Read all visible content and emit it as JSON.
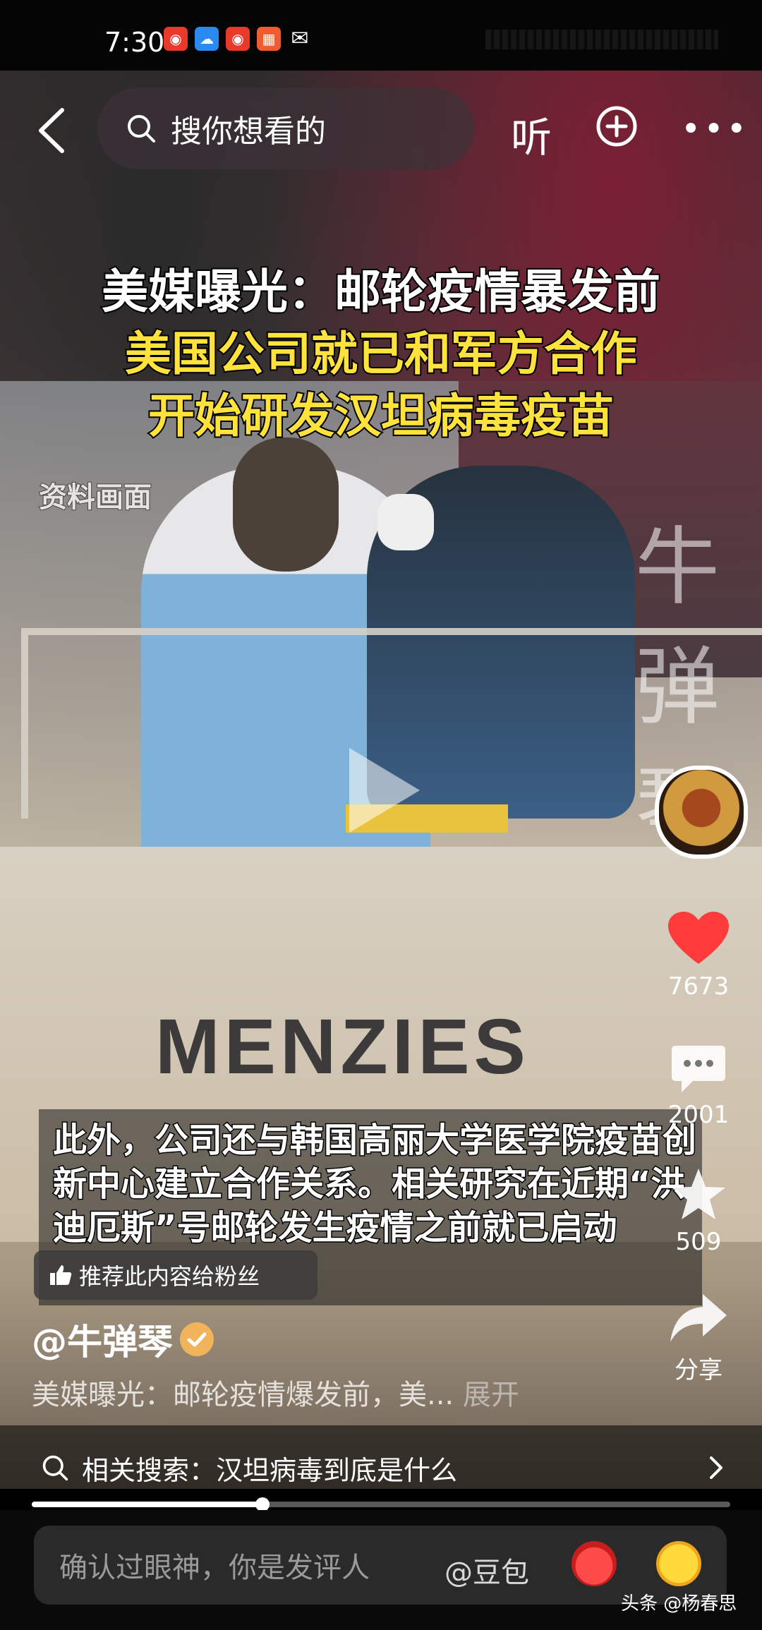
{
  "status_bar": {
    "time": "7:30"
  },
  "header": {
    "search_placeholder": "搜你想看的",
    "listen_label": "听"
  },
  "video": {
    "headline": [
      "美媒曝光：邮轮疫情暴发前",
      "美国公司就已和军方合作",
      "开始研发汉坦病毒疫苗"
    ],
    "archive_label": "资料画面",
    "watermark": "牛弹琴",
    "sign_text": "MENZIES",
    "subtitle": "此外，公司还与韩国高丽大学医学院疫苗创新中心建立合作关系。相关研究在近期“洪迪厄斯”号邮轮发生疫情之前就已启动",
    "recommend_label": "推荐此内容给粉丝"
  },
  "sidebar": {
    "likes": "7673",
    "comments": "2001",
    "favorites": "509",
    "share_label": "分享"
  },
  "author": {
    "name": "@牛弹琴",
    "description": "美媒曝光：邮轮疫情爆发前，美...",
    "expand_label": "展开"
  },
  "related_search": {
    "label": "相关搜索：汉坦病毒到底是什么"
  },
  "progress": {
    "fraction": 0.33
  },
  "comment_bar": {
    "placeholder": "确认过眼神，你是发评人",
    "mention": "@豆包"
  },
  "brand_watermark": "头条 @杨春思",
  "colors": {
    "headline_yellow": "#ffe23b",
    "like_red": "#ff3b3b",
    "verified_orange": "#f2b45a"
  }
}
